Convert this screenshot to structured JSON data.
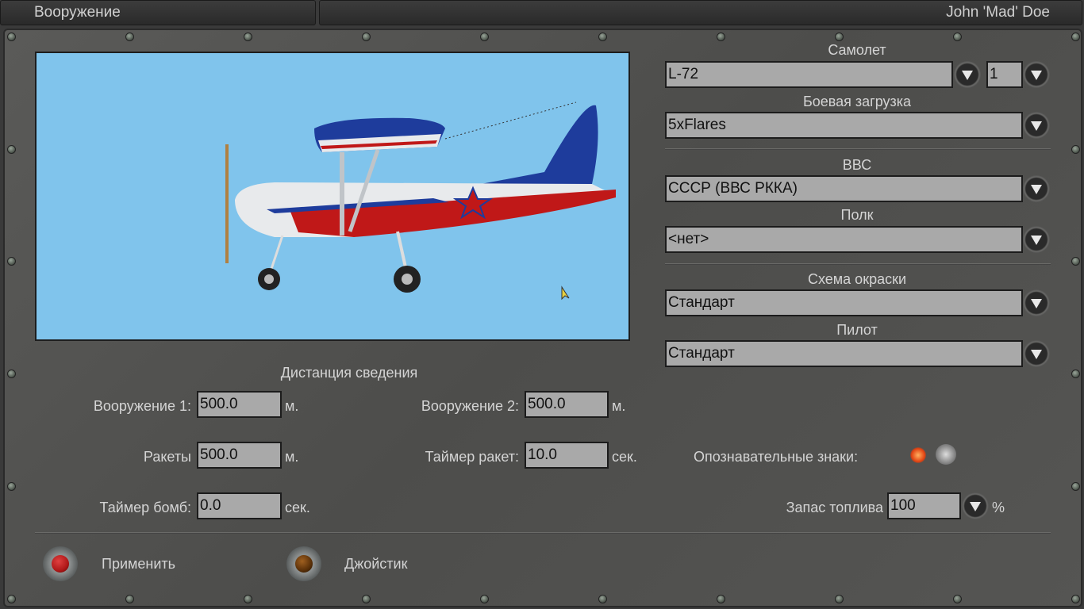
{
  "header": {
    "title": "Вооружение",
    "user": "John 'Mad' Doe"
  },
  "aircraft": {
    "label": "Самолет",
    "value": "L-72",
    "count": "1"
  },
  "loadout": {
    "label": "Боевая загрузка",
    "value": "5xFlares"
  },
  "airforce": {
    "label": "ВВС",
    "value": "СССР (ВВС РККА)"
  },
  "regiment": {
    "label": "Полк",
    "value": "<нет>"
  },
  "skin": {
    "label": "Схема окраски",
    "value": "Стандарт"
  },
  "pilot": {
    "label": "Пилот",
    "value": "Стандарт"
  },
  "convergence": {
    "title": "Дистанция сведения",
    "weapon1": {
      "label": "Вооружение 1:",
      "value": "500.0",
      "unit": "м."
    },
    "weapon2": {
      "label": "Вооружение 2:",
      "value": "500.0",
      "unit": "м."
    },
    "rockets": {
      "label": "Ракеты",
      "value": "500.0",
      "unit": "м."
    },
    "rocket_timer": {
      "label": "Таймер ракет:",
      "value": "10.0",
      "unit": "сек."
    },
    "bomb_timer": {
      "label": "Таймер бомб:",
      "value": "0.0",
      "unit": "сек."
    }
  },
  "markings": {
    "label": "Опознавательные знаки:",
    "enabled": true
  },
  "fuel": {
    "label": "Запас топлива",
    "value": "100",
    "unit": "%"
  },
  "buttons": {
    "apply": "Применить",
    "joystick": "Джойстик"
  },
  "colors": {
    "sky": "#80c4ec",
    "apply_lamp": "#b01818",
    "joystick_lamp": "#5a3008"
  }
}
